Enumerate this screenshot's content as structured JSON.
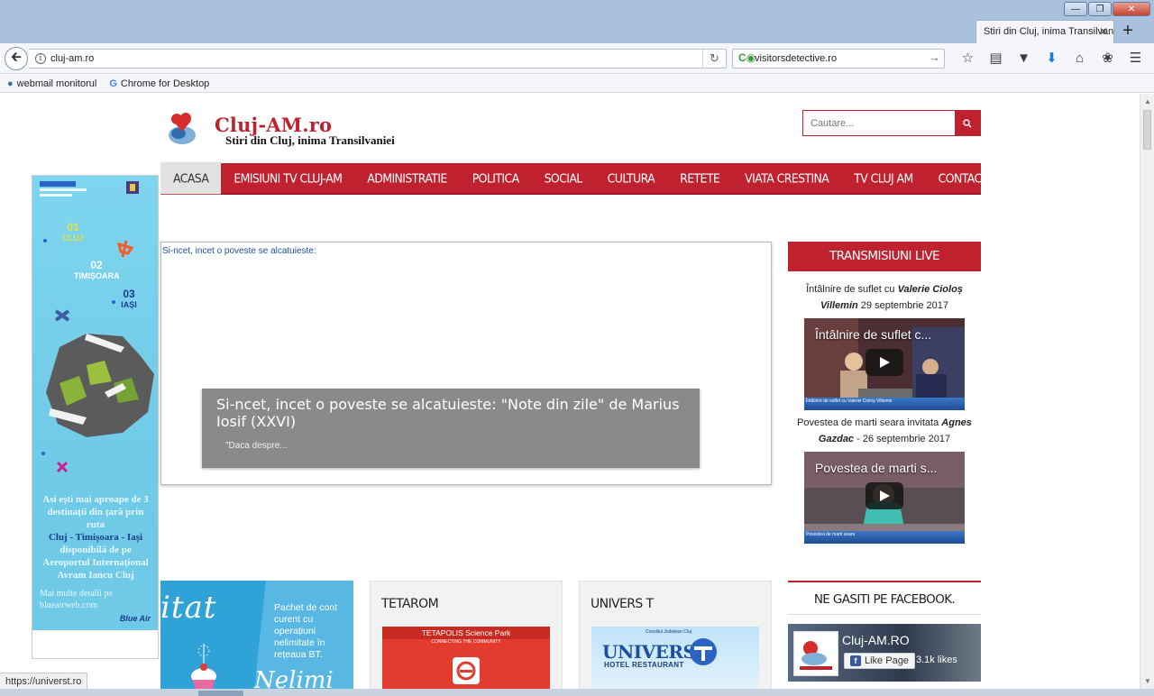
{
  "browser": {
    "tab_title": "Stiri din Cluj, inima Transilvaniei",
    "url": "cluj-am.ro",
    "search_value": "visitorsdetective.ro",
    "bookmarks": [
      {
        "label": "webmail monitorul",
        "icon": "globe-icon"
      },
      {
        "label": "Chrome for Desktop",
        "icon": "google-icon"
      }
    ],
    "status_text": "https://universt.ro"
  },
  "site": {
    "logo_title": "Cluj-AM.ro",
    "logo_subtitle": "Stiri din Cluj, inima Transilvaniei",
    "search_placeholder": "Cautare...",
    "brand_color": "#c0212f",
    "nav": [
      {
        "label": "ACASA",
        "active": true
      },
      {
        "label": "EMISIUNI TV CLUJ-AM"
      },
      {
        "label": "ADMINISTRATIE"
      },
      {
        "label": "POLITICA"
      },
      {
        "label": "SOCIAL"
      },
      {
        "label": "CULTURA"
      },
      {
        "label": "RETETE"
      },
      {
        "label": "VIATA CRESTINA"
      },
      {
        "label": "TV CLUJ AM"
      },
      {
        "label": "CONTACT"
      }
    ]
  },
  "left_ad": {
    "cities": [
      {
        "num": "01",
        "name": "CLUJ"
      },
      {
        "num": "02",
        "name": "TIMIȘOARA"
      },
      {
        "num": "03",
        "name": "IAȘI"
      }
    ],
    "text_line1": "Asi ești mai aproape de 3 destinații din țară prin ruta",
    "text_route": "Cluj - Timișoara - Iași",
    "text_line2": "disponibilă de pe Aeroportul Internațional Avram Iancu Cluj",
    "text_more": "Mai multe detalii pe blueairweb.com",
    "brand": "Blue Air"
  },
  "slider": {
    "top_link": "Si-ncet, incet o poveste se alcatuieste:",
    "caption_title": "Si-ncet, incet o poveste se alcatuieste: \"Note din zile\" de Marius Iosif (XXVI)",
    "caption_excerpt": "\"Daca despre..."
  },
  "live": {
    "heading": "TRANSMISIUNI LIVE",
    "items": [
      {
        "prefix": "Întâlnire de suflet cu ",
        "guest": "Valerie Cioloș Villemin",
        "suffix": " 29 septembrie 2017",
        "video_title": "Întâlnire de suflet c...",
        "strip": "Întâlnire de suflet cu Valerie Cioloș Villemin"
      },
      {
        "prefix": "Povestea de marti seara invitata ",
        "guest": "Agnes Gazdac",
        "suffix": " - 26 septembrie 2017",
        "video_title": "Povestea de marti s...",
        "strip": "Povestea de marti seara"
      }
    ]
  },
  "promo": {
    "big_text": "itat",
    "text": "Pachet de cont curent cu operațiuni nelimitate în rețeaua BT.",
    "big_text2": "Nelimi"
  },
  "boxes": [
    {
      "title": "TETAROM",
      "image_label": "TETAPOLIS Science Park",
      "image_sub": "CONNECTING THE COMMUNITY"
    },
    {
      "title": "UNIVERS T",
      "image_label": "UNIVERS",
      "image_sub": "HOTEL RESTAURANT",
      "image_top": "Consiliul Județean Cluj"
    }
  ],
  "facebook": {
    "heading": "NE GASITI PE FACEBOOK.",
    "page_name": "Cluj-AM.RO",
    "like_label": "Like Page",
    "likes": "3.1k likes"
  }
}
